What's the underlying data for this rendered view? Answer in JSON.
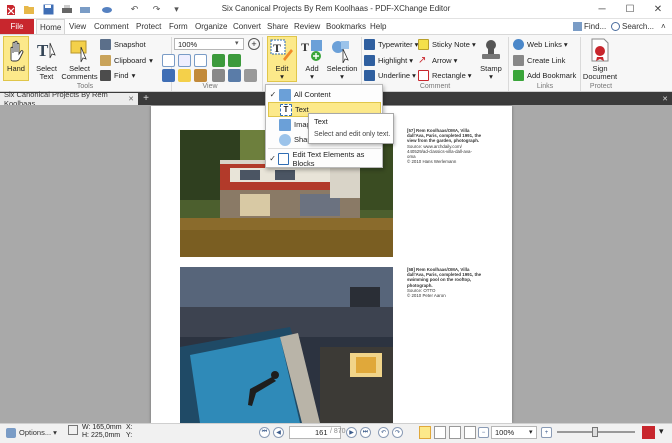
{
  "window": {
    "title": "Six Canonical Projects By Rem Koolhaas - PDF-XChange Editor",
    "minimize": "─",
    "maximize": "☐",
    "close": "✕"
  },
  "ribbon_tabs": [
    "File",
    "Home",
    "View",
    "Comment",
    "Protect",
    "Form",
    "Organize",
    "Convert",
    "Share",
    "Review",
    "Bookmarks",
    "Help"
  ],
  "ribbon_right": {
    "find": "Find...",
    "search": "Search..."
  },
  "tools": {
    "hand": "Hand",
    "select_text": "Select\nText",
    "select_comments": "Select\nComments",
    "snapshot": "Snapshot",
    "clipboard": "Clipboard",
    "find": "Find",
    "label": "Tools"
  },
  "view": {
    "zoom": "100%",
    "label": "View"
  },
  "objects": {
    "edit": "Edit",
    "add": "Add",
    "selection": "Selection"
  },
  "comment": {
    "typewriter": "Typewriter",
    "sticky_note": "Sticky Note",
    "highlight": "Highlight",
    "arrow": "Arrow",
    "underline": "Underline",
    "rectangle": "Rectangle",
    "stamp": "Stamp",
    "label": "Comment"
  },
  "links": {
    "web_links": "Web Links",
    "create_link": "Create Link",
    "add_bookmark": "Add Bookmark",
    "label": "Links"
  },
  "protect": {
    "sign": "Sign\nDocument",
    "label": "Protect"
  },
  "document_tab": {
    "name": "Six Canonical Projects By Rem Koolhaas",
    "close": "✕",
    "new": "+"
  },
  "dropdown": {
    "items": [
      {
        "label": "All Content",
        "checked": true
      },
      {
        "label": "Text",
        "checked": false
      },
      {
        "label": "Images",
        "checked": false
      },
      {
        "label": "Shapes",
        "checked": false
      },
      {
        "label": "Edit Text Elements as Blocks",
        "checked": true
      }
    ],
    "visible_partial": [
      "Imag",
      "Shap"
    ]
  },
  "tooltip": {
    "title": "Text",
    "text": "Select and edit only text."
  },
  "captions": {
    "c1": [
      "[57] Rem Koolhaas/OMA, Villa",
      "dall'Ava, Paris, completed 1991, the",
      "view from the garden, photograph.",
      "Source: www.archdaily.com/",
      "440529/ad-classics-villa-dall-ava-",
      "oma",
      "© 2010 Hans Werlemann"
    ],
    "c2": [
      "[58] Rem Koolhaas/OMA, Villa",
      "dall'Ava, Paris, completed 1991, the",
      "swimming pool on the rooftop,",
      "photograph.",
      "Source: OTTO",
      "© 2010 Peter Aaron"
    ]
  },
  "status": {
    "options": "Options...",
    "width": "W: 165,0mm",
    "height": "H: 225,0mm",
    "x": "X:",
    "y": "Y:",
    "page_current": "161",
    "page_total": "/ 870",
    "zoom": "100%"
  },
  "colors": {
    "file_tab": "#c8262d",
    "doc_tab_bar": "#3b3b3b",
    "workspace": "#a9a9a9",
    "highlight": "#fce98a"
  }
}
